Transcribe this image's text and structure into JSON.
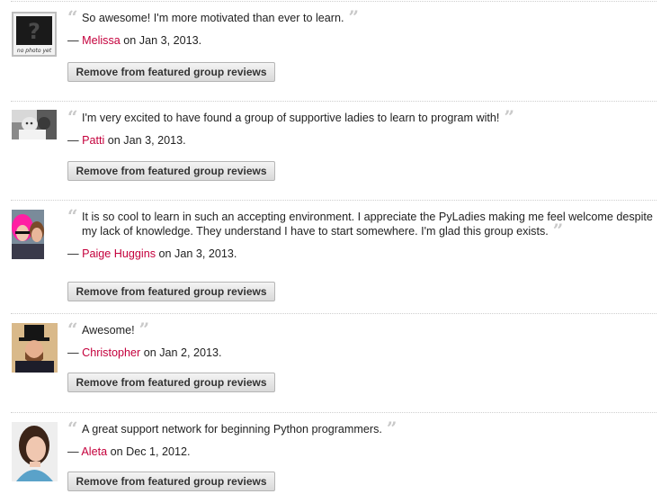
{
  "reviews": [
    {
      "quote": "So awesome! I'm more motivated than ever to learn.",
      "dash": "—",
      "author": "Melissa",
      "date": "on Jan 3, 2013.",
      "avatar_text": "no photo yet",
      "avatar_type": "no-photo-icon",
      "button_label": "Remove from featured group reviews"
    },
    {
      "quote": "I'm very excited to have found a group of supportive ladies to learn to program with!",
      "dash": "—",
      "author": "Patti",
      "date": "on Jan 3, 2013.",
      "avatar_type": "baby-photo",
      "button_label": "Remove from featured group reviews"
    },
    {
      "quote": "It is so cool to learn in such an accepting environment. I appreciate the PyLadies making me feel welcome despite my lack of knowledge. They understand I have to start somewhere. I'm glad this group exists.",
      "dash": "—",
      "author": "Paige Huggins",
      "date": "on Jan 3, 2013.",
      "avatar_type": "pink-wig-photo",
      "button_label": "Remove from featured group reviews"
    },
    {
      "quote": "Awesome!",
      "dash": "—",
      "author": "Christopher",
      "date": "on Jan 2, 2013.",
      "avatar_type": "top-hat-photo",
      "button_label": "Remove from featured group reviews"
    },
    {
      "quote": "A great support network for beginning Python programmers.",
      "dash": "—",
      "author": "Aleta",
      "date": "on Dec 1, 2012.",
      "avatar_type": "woman-portrait-photo",
      "button_label": "Remove from featured group reviews"
    }
  ],
  "colors": {
    "author_link": "#c4003c",
    "quote_mark": "#c9c9c9",
    "divider": "#cfcfcf"
  }
}
